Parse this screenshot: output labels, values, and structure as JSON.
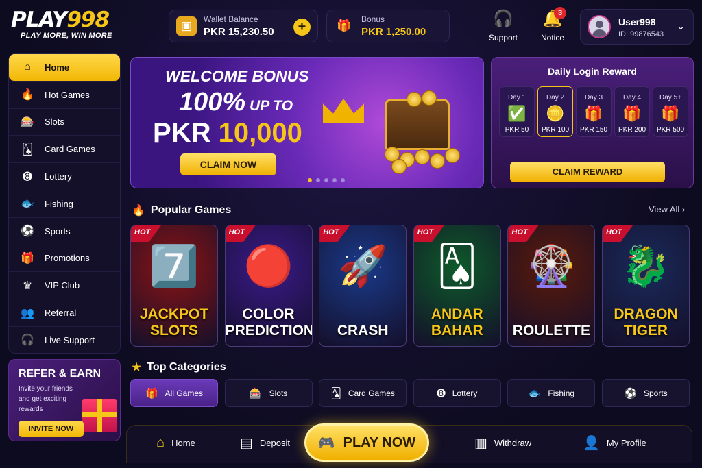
{
  "brand": {
    "name_a": "PLAY",
    "name_b": "998",
    "tagline": "PLAY MORE, WIN MORE"
  },
  "wallet": {
    "label": "Wallet Balance",
    "value": "PKR 15,230.50",
    "icon": "wallet-icon",
    "add": "+"
  },
  "bonus": {
    "label": "Bonus",
    "value": "PKR 1,250.00",
    "icon": "gift-icon"
  },
  "header": {
    "support": "Support",
    "notice": "Notice",
    "notice_count": "3"
  },
  "user": {
    "name": "User998",
    "id": "ID: 99876543"
  },
  "sidebar": {
    "items": [
      {
        "label": "Home",
        "icon": "home-icon",
        "glyph": "⌂"
      },
      {
        "label": "Hot Games",
        "icon": "flame-icon",
        "glyph": "🔥"
      },
      {
        "label": "Slots",
        "icon": "slot-machine-icon",
        "glyph": "🎰"
      },
      {
        "label": "Card Games",
        "icon": "cards-icon",
        "glyph": "🂡"
      },
      {
        "label": "Lottery",
        "icon": "lottery-ball-icon",
        "glyph": "➑"
      },
      {
        "label": "Fishing",
        "icon": "fish-icon",
        "glyph": "🐟"
      },
      {
        "label": "Sports",
        "icon": "soccer-ball-icon",
        "glyph": "⚽"
      },
      {
        "label": "Promotions",
        "icon": "gift-icon",
        "glyph": "🎁"
      },
      {
        "label": "VIP Club",
        "icon": "crown-icon",
        "glyph": "♛"
      },
      {
        "label": "Referral",
        "icon": "users-icon",
        "glyph": "👥"
      },
      {
        "label": "Live Support",
        "icon": "headset-icon",
        "glyph": "🎧"
      }
    ]
  },
  "refer": {
    "title": "REFER & EARN",
    "text": "Invite your friends and get exciting rewards",
    "button": "INVITE NOW"
  },
  "banner": {
    "line1": "WELCOME BONUS",
    "line2_big": "100%",
    "line2_small": " UP TO",
    "line3_a": "PKR ",
    "line3_b": "10,000",
    "button": "CLAIM NOW",
    "slides": 5,
    "active_slide": 0
  },
  "daily": {
    "title": "Daily Login Reward",
    "button": "CLAIM REWARD",
    "days": [
      {
        "day": "Day 1",
        "value": "PKR 50",
        "icon": "check-icon",
        "glyph": "✅"
      },
      {
        "day": "Day 2",
        "value": "PKR 100",
        "icon": "coin-icon",
        "glyph": "🪙"
      },
      {
        "day": "Day 3",
        "value": "PKR 150",
        "icon": "gift-icon",
        "glyph": "🎁"
      },
      {
        "day": "Day 4",
        "value": "PKR 200",
        "icon": "gift-icon",
        "glyph": "🎁"
      },
      {
        "day": "Day 5+",
        "value": "PKR 500",
        "icon": "gift-icon",
        "glyph": "🎁"
      }
    ]
  },
  "popular": {
    "title": "Popular Games",
    "view_all": "View All ›",
    "games": [
      {
        "title": "JACKPOT SLOTS",
        "badge": "HOT",
        "art": "7️⃣",
        "bg": "#8a1414",
        "color": "#f5c518"
      },
      {
        "title": "COLOR PREDICTION",
        "badge": "HOT",
        "art": "🔴",
        "bg": "#3a1a8a",
        "color": "#ffffff"
      },
      {
        "title": "CRASH",
        "badge": "HOT",
        "art": "🚀",
        "bg": "#1a3a8a",
        "color": "#ffffff"
      },
      {
        "title": "ANDAR BAHAR",
        "badge": "HOT",
        "art": "🂡",
        "bg": "#0e5a2a",
        "color": "#f5c518"
      },
      {
        "title": "ROULETTE",
        "badge": "HOT",
        "art": "🎡",
        "bg": "#5a1a0a",
        "color": "#ffffff"
      },
      {
        "title": "DRAGON TIGER",
        "badge": "HOT",
        "art": "🐉",
        "bg": "#1a2a5a",
        "color": "#f5c518"
      }
    ]
  },
  "categories": {
    "title": "Top Categories",
    "items": [
      {
        "label": "All Games",
        "icon": "gift-icon",
        "glyph": "🎁"
      },
      {
        "label": "Slots",
        "icon": "slot-machine-icon",
        "glyph": "🎰"
      },
      {
        "label": "Card Games",
        "icon": "cards-icon",
        "glyph": "🂡"
      },
      {
        "label": "Lottery",
        "icon": "lottery-ball-icon",
        "glyph": "➑"
      },
      {
        "label": "Fishing",
        "icon": "fish-icon",
        "glyph": "🐟"
      },
      {
        "label": "Sports",
        "icon": "soccer-ball-icon",
        "glyph": "⚽"
      }
    ]
  },
  "bottom": {
    "home": "Home",
    "deposit": "Deposit",
    "play": "PLAY NOW",
    "withdraw": "Withdraw",
    "profile": "My Profile"
  },
  "colors": {
    "accent": "#f5c518",
    "background": "#0d0b1f",
    "purple": "#4a1f7a"
  }
}
